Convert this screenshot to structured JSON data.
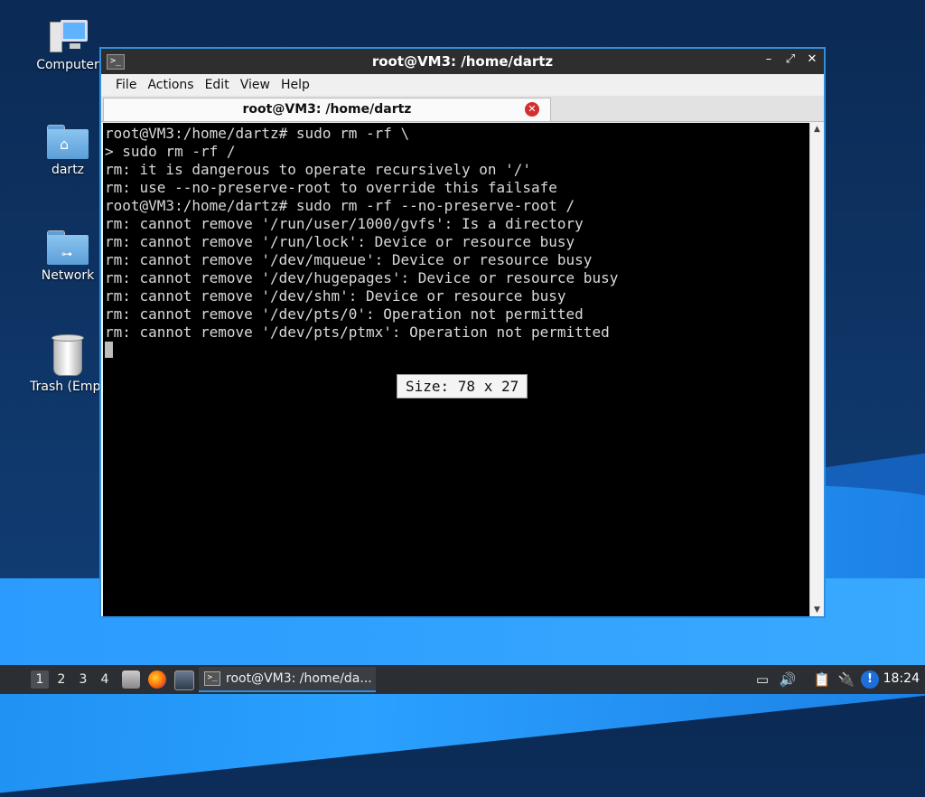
{
  "desktop": {
    "icons": [
      {
        "label": "Computer"
      },
      {
        "label": "dartz"
      },
      {
        "label": "Network"
      },
      {
        "label": "Trash (Empt"
      }
    ]
  },
  "window": {
    "title": "root@VM3: /home/dartz",
    "app_icon": ">_",
    "controls": {
      "minimize": "–",
      "maximize": "⤢",
      "close": "✕"
    },
    "menu": [
      "File",
      "Actions",
      "Edit",
      "View",
      "Help"
    ],
    "tab": {
      "title": "root@VM3: /home/dartz",
      "close": "✕"
    },
    "terminal_lines": [
      "root@VM3:/home/dartz# sudo rm -rf \\",
      "> sudo rm -rf /",
      "rm: it is dangerous to operate recursively on '/'",
      "rm: use --no-preserve-root to override this failsafe",
      "root@VM3:/home/dartz# sudo rm -rf --no-preserve-root /",
      "rm: cannot remove '/run/user/1000/gvfs': Is a directory",
      "rm: cannot remove '/run/lock': Device or resource busy",
      "rm: cannot remove '/dev/mqueue': Device or resource busy",
      "rm: cannot remove '/dev/hugepages': Device or resource busy",
      "rm: cannot remove '/dev/shm': Device or resource busy",
      "rm: cannot remove '/dev/pts/0': Operation not permitted",
      "rm: cannot remove '/dev/pts/ptmx': Operation not permitted"
    ],
    "size_tooltip": "Size: 78 x 27",
    "scroll": {
      "up": "▲",
      "down": "▼"
    }
  },
  "taskbar": {
    "workspaces": [
      "1",
      "2",
      "3",
      "4"
    ],
    "active_workspace": 0,
    "launchers": [
      "file-manager-icon",
      "firefox-icon",
      "terminal-launcher-icon"
    ],
    "task_title": "root@VM3: /home/da...",
    "tray": {
      "battery": "▭",
      "volume": "🔊",
      "clipboard": "📋",
      "network": "🔌",
      "updates": "!"
    },
    "clock": "18:24"
  },
  "colors": {
    "accent": "#2f8fe0",
    "terminal_bg": "#000000",
    "terminal_fg": "#d9d9d9"
  }
}
